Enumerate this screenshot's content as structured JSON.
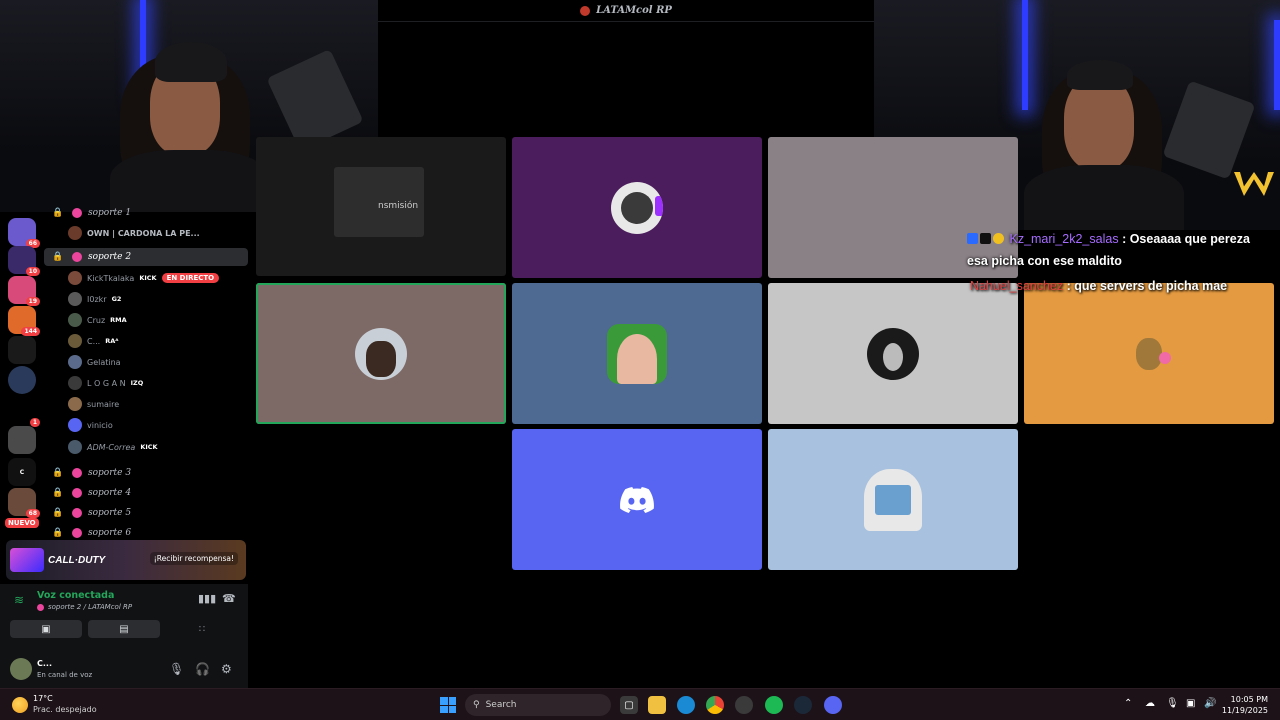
{
  "window": {
    "title": "LATAMcol RP"
  },
  "sidebar": {
    "guild_badges": [
      "66",
      "10",
      "19",
      "144",
      "1",
      "68"
    ],
    "nuevo_label": "NUEVO",
    "channels": [
      {
        "name": "soporte 1",
        "top": 0
      },
      {
        "name": "soporte 2",
        "active": true
      },
      {
        "name": "soporte 3"
      },
      {
        "name": "soporte 4"
      },
      {
        "name": "soporte 5"
      },
      {
        "name": "soporte 6"
      }
    ],
    "top_member": "OWN | CARDONA LA PE...",
    "members": [
      {
        "name": "KickTkalaka",
        "tag": "KICK",
        "live": "EN DIRECTO",
        "color": "#7a4a3a"
      },
      {
        "name": "I0zkr",
        "tag": "G2",
        "color": "#5a5a5a"
      },
      {
        "name": "Cruz",
        "tag": "RMA",
        "color": "#4a5a4a"
      },
      {
        "name": "C...",
        "tag": "RAᴬ",
        "color": "#6a5a3a"
      },
      {
        "name": "Gelatina",
        "tag": "",
        "color": "#5a6a8a"
      },
      {
        "name": "L O G A N",
        "tag": "IZQ",
        "color": "#3a3a3a"
      },
      {
        "name": "sumaire",
        "tag": "",
        "color": "#8a6a4a"
      },
      {
        "name": "vinicio",
        "tag": "",
        "color": "#5865f2"
      },
      {
        "name": "ADM-Correa",
        "tag": "KICK",
        "color": "#4a5a6a"
      }
    ]
  },
  "banner": {
    "game": "CALL·DUTY",
    "reward": "¡Recibir recompensa!"
  },
  "voice": {
    "status": "Voz conectada",
    "channel": "soporte 2 / LATAMcol RP",
    "user_name": "C...",
    "user_status": "En canal de voz"
  },
  "stage": {
    "screen_share_text": "nsmisión"
  },
  "chat": [
    {
      "user": "Kz_mari_2k2_salas",
      "message": ": Oseaaaa que pereza",
      "continuation": "esa picha con ese maldito"
    },
    {
      "user": "Nahuel_sanchez",
      "message": ": que servers de picha mae"
    }
  ],
  "taskbar": {
    "weather_temp": "17°C",
    "weather_desc": "Prac. despejado",
    "search_label": "Search",
    "time": "10:05 PM",
    "date": "11/19/2025"
  },
  "colors": {
    "accent": "#5865f2",
    "online": "#23a55a",
    "danger": "#f23f43"
  }
}
